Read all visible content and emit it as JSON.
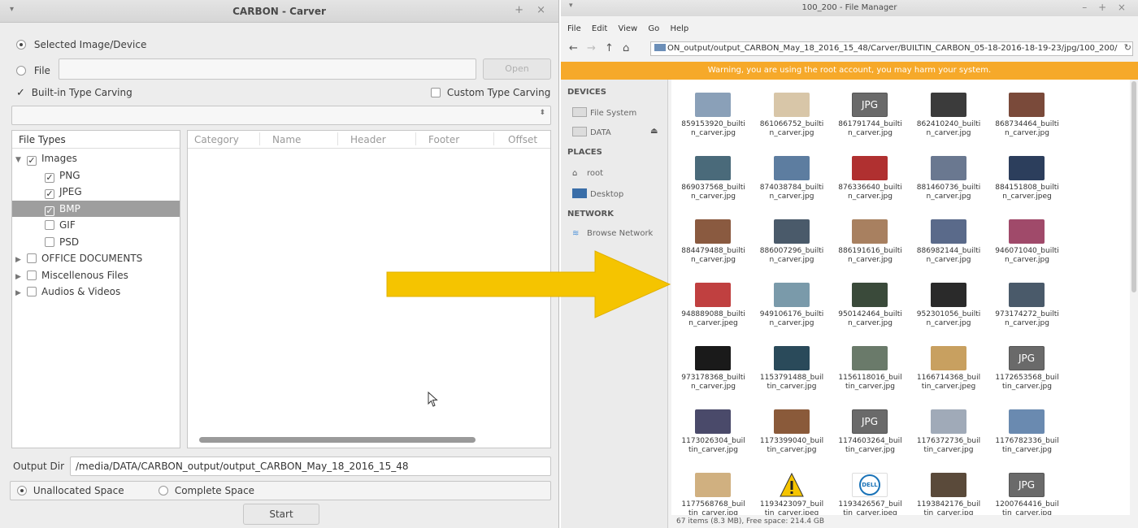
{
  "carver": {
    "title": "CARBON - Carver",
    "source_selected": "Selected Image/Device",
    "source_file": "File",
    "open_button": "Open",
    "builtin_label": "Built-in Type Carving",
    "custom_label": "Custom Type Carving",
    "file_types_header": "File Types",
    "tree": [
      {
        "label": "Images",
        "level": 0,
        "expander": "▼",
        "checked": true
      },
      {
        "label": "PNG",
        "level": 1,
        "checked": true
      },
      {
        "label": "JPEG",
        "level": 1,
        "checked": true
      },
      {
        "label": "BMP",
        "level": 1,
        "checked": true,
        "selected": true
      },
      {
        "label": "GIF",
        "level": 1,
        "checked": false
      },
      {
        "label": "PSD",
        "level": 1,
        "checked": false
      },
      {
        "label": "OFFICE DOCUMENTS",
        "level": 0,
        "expander": "▶",
        "checked": false
      },
      {
        "label": "Miscellenous Files",
        "level": 0,
        "expander": "▶",
        "checked": false
      },
      {
        "label": "Audios & Videos",
        "level": 0,
        "expander": "▶",
        "checked": false
      }
    ],
    "columns": [
      "Category",
      "Name",
      "Header",
      "Footer",
      "Offset"
    ],
    "output_dir_label": "Output Dir",
    "output_dir_value": "/media/DATA/CARBON_output/output_CARBON_May_18_2016_15_48",
    "space_unallocated": "Unallocated Space",
    "space_complete": "Complete Space",
    "start_button": "Start"
  },
  "filemanager": {
    "title": "100_200 - File Manager",
    "menu": [
      "File",
      "Edit",
      "View",
      "Go",
      "Help"
    ],
    "path": "ON_output/output_CARBON_May_18_2016_15_48/Carver/BUILTIN_CARBON_05-18-2016-18-19-23/jpg/100_200/",
    "warning": "Warning, you are using the root account, you may harm your system.",
    "devices_head": "DEVICES",
    "places_head": "PLACES",
    "network_head": "NETWORK",
    "side_items": {
      "file_system": "File System",
      "data": "DATA",
      "root": "root",
      "desktop": "Desktop",
      "browse_network": "Browse Network"
    },
    "files": [
      {
        "l1": "859153920_builti",
        "l2": "n_carver.jpg",
        "thumb": "#8aa0b8"
      },
      {
        "l1": "861066752_builti",
        "l2": "n_carver.jpg",
        "thumb": "#d8c6a8"
      },
      {
        "l1": "861791744_builti",
        "l2": "n_carver.jpg",
        "thumb": "jpg"
      },
      {
        "l1": "862410240_builti",
        "l2": "n_carver.jpg",
        "thumb": "#3b3b3b"
      },
      {
        "l1": "868734464_builti",
        "l2": "n_carver.jpg",
        "thumb": "#7a4a3a"
      },
      {
        "l1": "869037568_builti",
        "l2": "n_carver.jpg",
        "thumb": "#4a6a7a"
      },
      {
        "l1": "874038784_builti",
        "l2": "n_carver.jpg",
        "thumb": "#5d7da0"
      },
      {
        "l1": "876336640_builti",
        "l2": "n_carver.jpg",
        "thumb": "#b03030"
      },
      {
        "l1": "881460736_builti",
        "l2": "n_carver.jpg",
        "thumb": "#6a7890"
      },
      {
        "l1": "884151808_builti",
        "l2": "n_carver.jpeg",
        "thumb": "#2c3e5c"
      },
      {
        "l1": "884479488_builti",
        "l2": "n_carver.jpg",
        "thumb": "#8a5a40"
      },
      {
        "l1": "886007296_builti",
        "l2": "n_carver.jpg",
        "thumb": "#4a5a6a"
      },
      {
        "l1": "886191616_builti",
        "l2": "n_carver.jpg",
        "thumb": "#a88060"
      },
      {
        "l1": "886982144_builti",
        "l2": "n_carver.jpg",
        "thumb": "#5a6a8a"
      },
      {
        "l1": "946071040_builti",
        "l2": "n_carver.jpg",
        "thumb": "#a04a6a"
      },
      {
        "l1": "948889088_builti",
        "l2": "n_carver.jpeg",
        "thumb": "#c04040"
      },
      {
        "l1": "949106176_builti",
        "l2": "n_carver.jpg",
        "thumb": "#7a9aaa"
      },
      {
        "l1": "950142464_builti",
        "l2": "n_carver.jpg",
        "thumb": "#3a4a3a"
      },
      {
        "l1": "952301056_builti",
        "l2": "n_carver.jpg",
        "thumb": "#2a2a2a"
      },
      {
        "l1": "973174272_builti",
        "l2": "n_carver.jpg",
        "thumb": "#4a5a6a"
      },
      {
        "l1": "973178368_builti",
        "l2": "n_carver.jpg",
        "thumb": "#1a1a1a"
      },
      {
        "l1": "1153791488_buil",
        "l2": "tin_carver.jpg",
        "thumb": "#2a4a5a"
      },
      {
        "l1": "1156118016_buil",
        "l2": "tin_carver.jpg",
        "thumb": "#6a7a6a"
      },
      {
        "l1": "1166714368_buil",
        "l2": "tin_carver.jpeg",
        "thumb": "#c8a060"
      },
      {
        "l1": "1172653568_buil",
        "l2": "tin_carver.jpg",
        "thumb": "jpg"
      },
      {
        "l1": "1173026304_buil",
        "l2": "tin_carver.jpg",
        "thumb": "#4a4a6a"
      },
      {
        "l1": "1173399040_buil",
        "l2": "tin_carver.jpg",
        "thumb": "#8a5a3a"
      },
      {
        "l1": "1174603264_buil",
        "l2": "tin_carver.jpg",
        "thumb": "jpg"
      },
      {
        "l1": "1176372736_buil",
        "l2": "tin_carver.jpg",
        "thumb": "#a0aab8"
      },
      {
        "l1": "1176782336_buil",
        "l2": "tin_carver.jpg",
        "thumb": "#6a8ab0"
      },
      {
        "l1": "1177568768_buil",
        "l2": "tin_carver.jpg",
        "thumb": "#d0b080"
      },
      {
        "l1": "1193423097_buil",
        "l2": "tin_carver.jpeg",
        "thumb": "warn"
      },
      {
        "l1": "1193426567_buil",
        "l2": "tin_carver.jpeg",
        "thumb": "#ffffff"
      },
      {
        "l1": "1193842176_buil",
        "l2": "tin_carver.jpg",
        "thumb": "#5a4a3a"
      },
      {
        "l1": "1200764416_buil",
        "l2": "tin_carver.jpg",
        "thumb": "jpg"
      }
    ],
    "jpg_label": "JPG",
    "status": "67 items (8.3 MB), Free space: 214.4 GB"
  },
  "colors": {
    "warning_bar": "#f6a92a",
    "arrow": "#f5c400",
    "selection": "#9e9e9e"
  }
}
